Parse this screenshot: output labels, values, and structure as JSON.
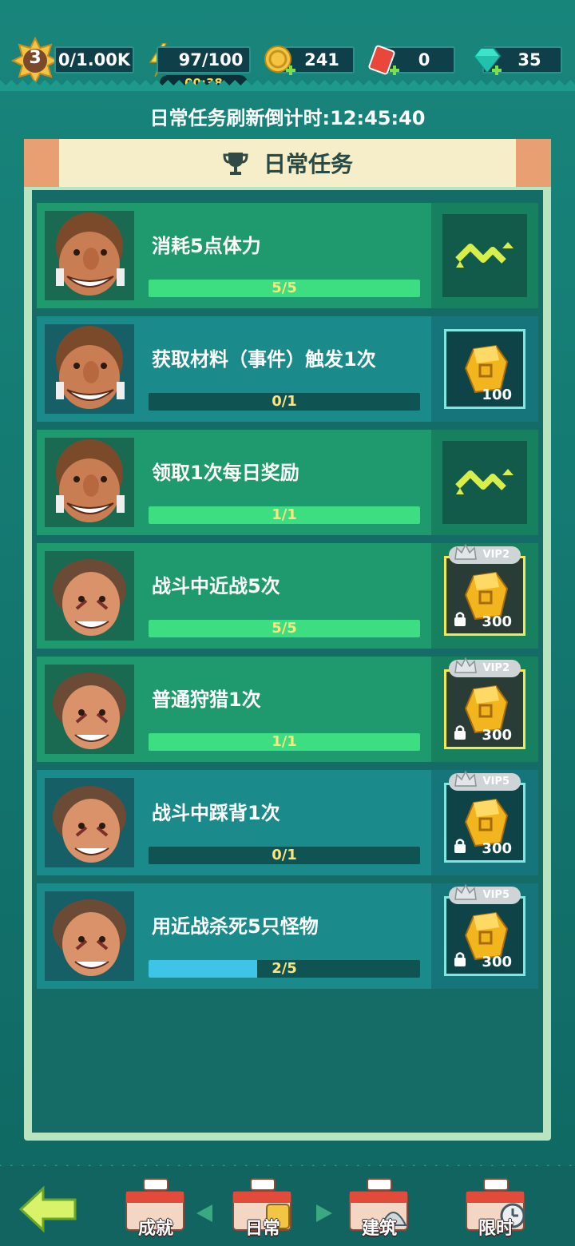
{
  "resources": {
    "level": "3",
    "exp": "0/1.00K",
    "stamina": "97/100",
    "stamina_timer": "00:38",
    "coins": "241",
    "tickets": "0",
    "gems": "35"
  },
  "refresh_text": "日常任务刷新倒计时:12:45:40",
  "panel_title": "日常任务",
  "tasks": [
    {
      "name": "消耗5点体力",
      "progress": "5/5",
      "fraction": 1.0,
      "style": "green",
      "reward": "claimed",
      "amount": "",
      "vip": ""
    },
    {
      "name": "获取材料（事件）触发1次",
      "progress": "0/1",
      "fraction": 0.0,
      "style": "teal",
      "reward": "cyan",
      "amount": "100",
      "vip": ""
    },
    {
      "name": "领取1次每日奖励",
      "progress": "1/1",
      "fraction": 1.0,
      "style": "green",
      "reward": "claimed",
      "amount": "",
      "vip": ""
    },
    {
      "name": "战斗中近战5次",
      "progress": "5/5",
      "fraction": 1.0,
      "style": "green",
      "reward": "gold",
      "amount": "300",
      "vip": "VIP2"
    },
    {
      "name": "普通狩猎1次",
      "progress": "1/1",
      "fraction": 1.0,
      "style": "green",
      "reward": "gold",
      "amount": "300",
      "vip": "VIP2"
    },
    {
      "name": "战斗中踩背1次",
      "progress": "0/1",
      "fraction": 0.0,
      "style": "teal",
      "reward": "locked",
      "amount": "300",
      "vip": "VIP5"
    },
    {
      "name": "用近战杀死5只怪物",
      "progress": "2/5",
      "fraction": 0.4,
      "style": "teal",
      "reward": "locked",
      "amount": "300",
      "vip": "VIP5"
    }
  ],
  "nav": {
    "achievements": "成就",
    "daily": "日常",
    "building": "建筑",
    "limited": "限时"
  },
  "colors": {
    "bar_complete": "#3dde82",
    "bar_partial": "#3ec4e6",
    "progress_text": "#ffe47a",
    "panel_header": "#f5eec8"
  }
}
